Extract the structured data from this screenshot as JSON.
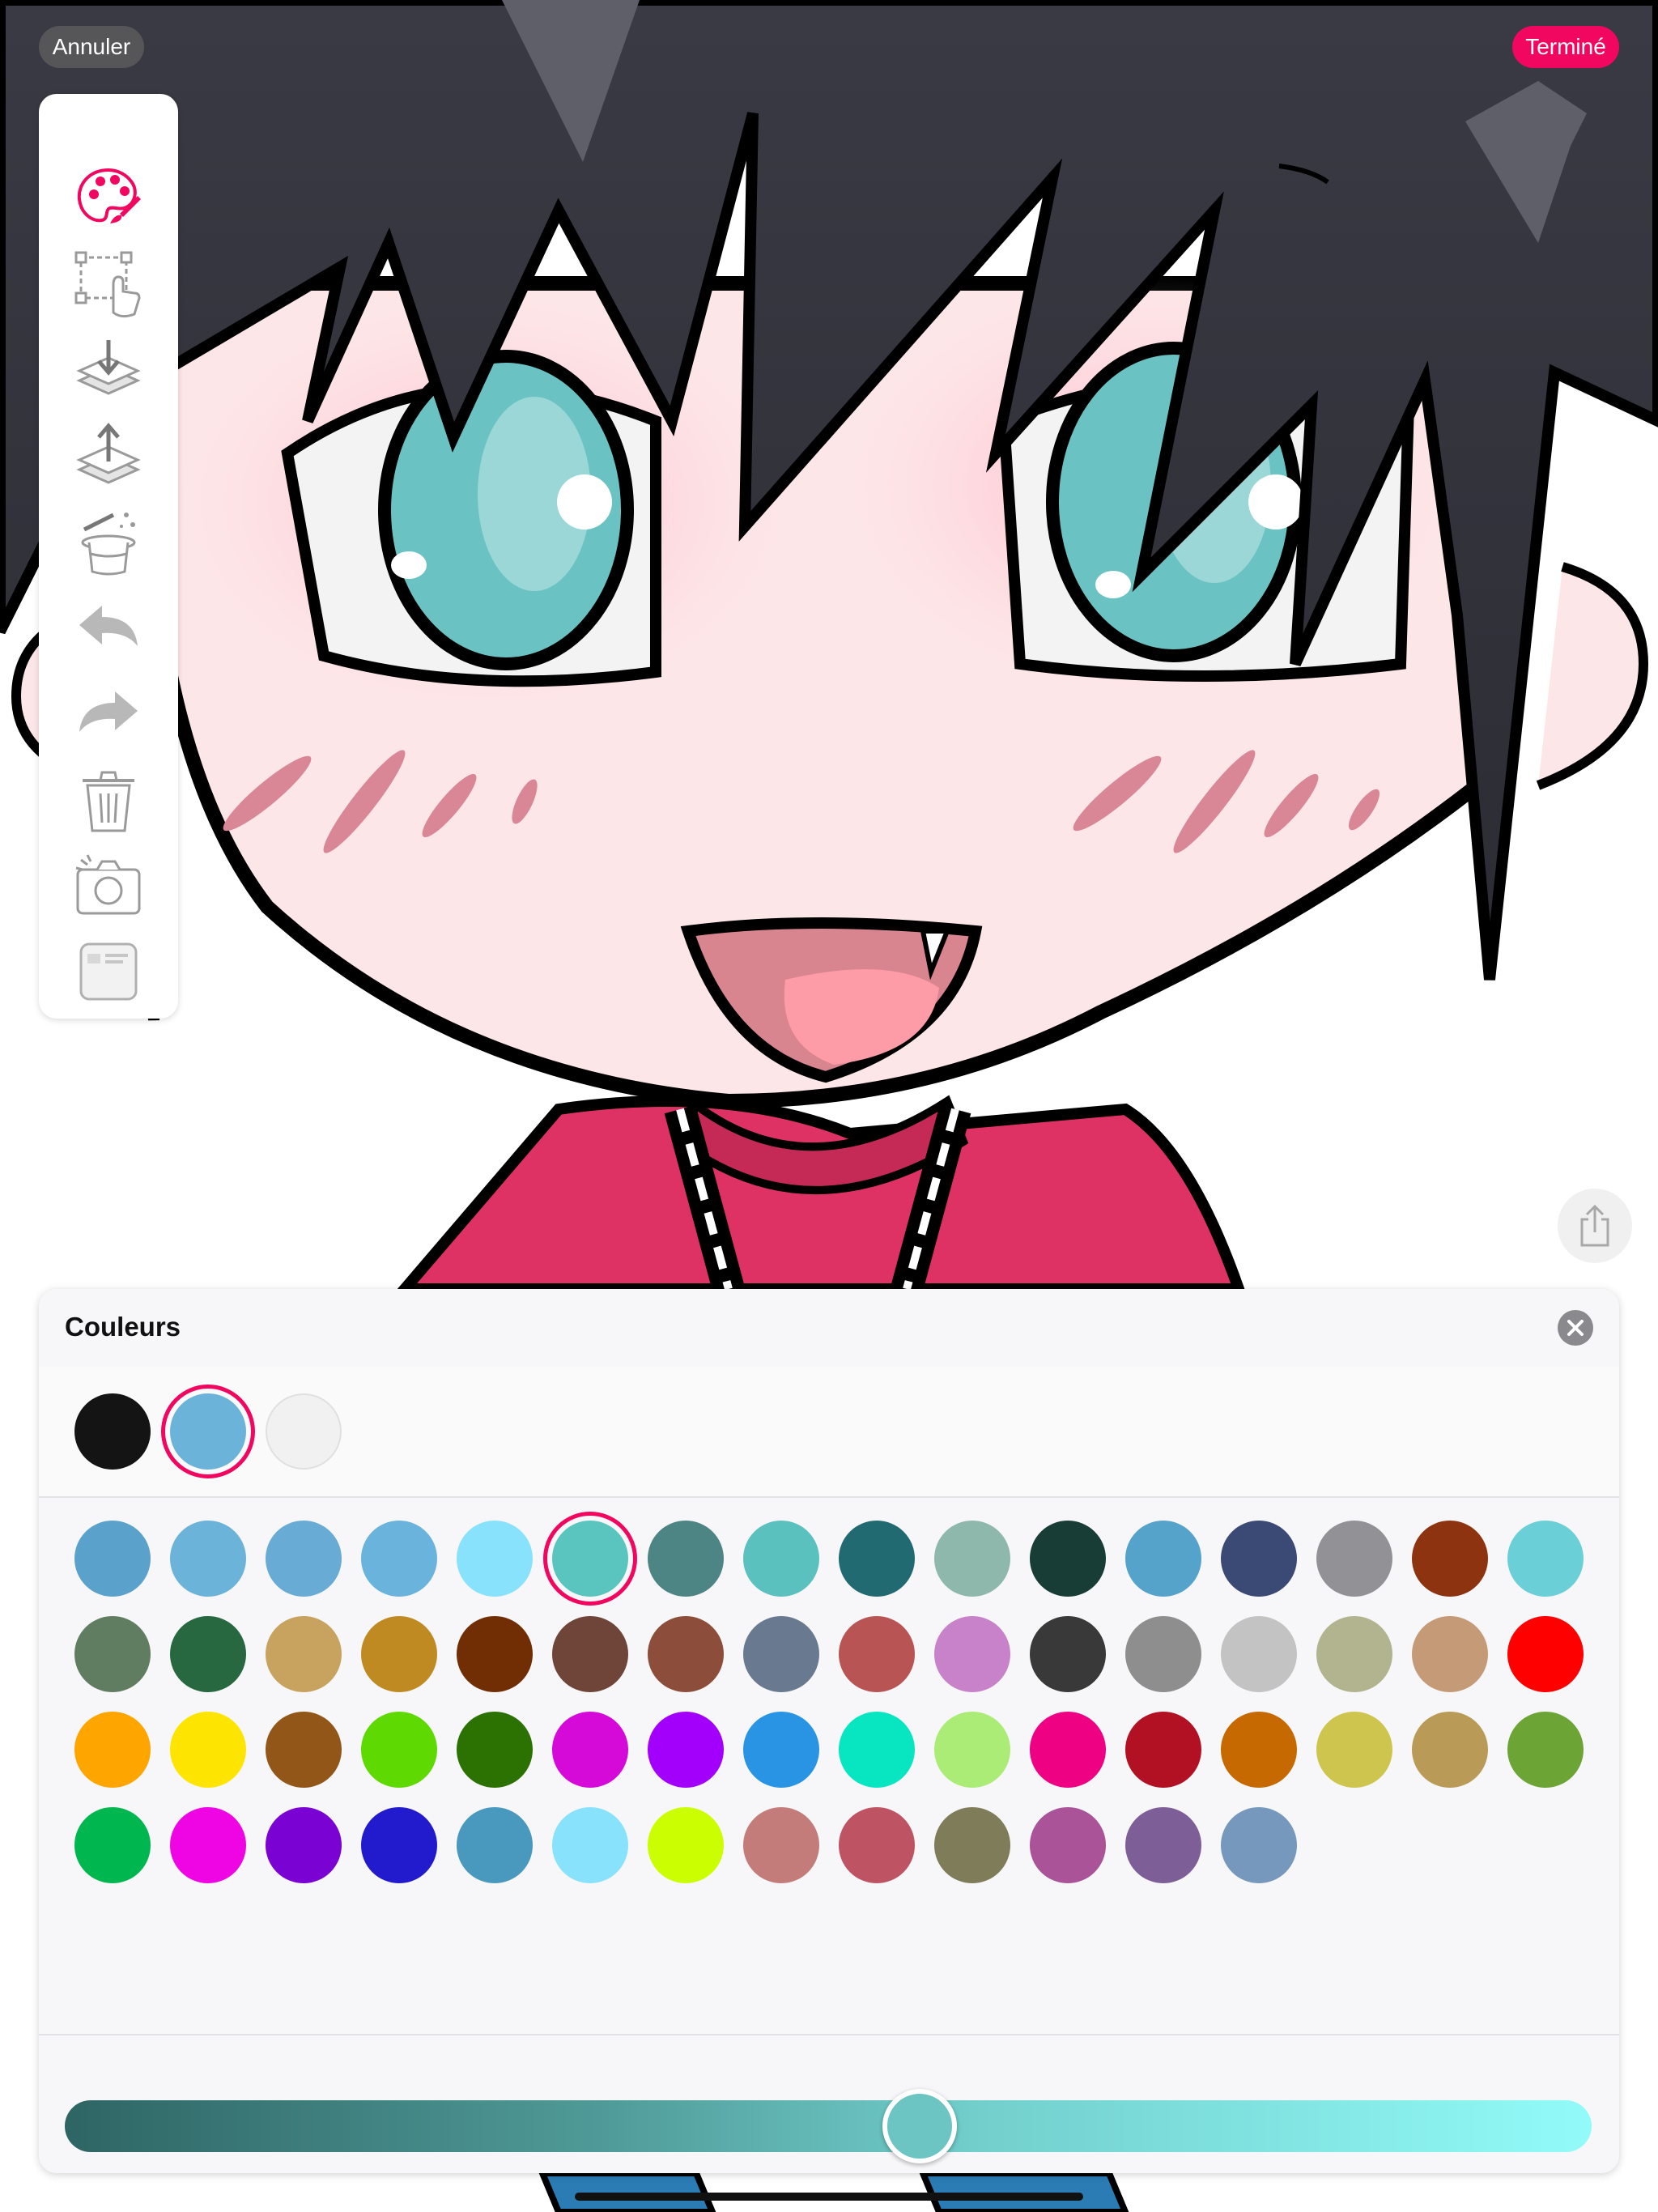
{
  "top_bar": {
    "cancel_label": "Annuler",
    "done_label": "Terminé"
  },
  "toolbar": {
    "tools": [
      "palette-icon",
      "select-transform-icon",
      "layer-down-icon",
      "layer-up-icon",
      "magic-hat-icon",
      "undo-icon",
      "redo-icon",
      "trash-icon",
      "camera-icon",
      "card-icon"
    ]
  },
  "panel": {
    "title": "Couleurs",
    "recent_colors": [
      "#141414",
      "#6cb3da",
      "#f1f1f1"
    ],
    "recent_selected_index": 1,
    "palette": [
      "#5aa2cc",
      "#6cb3da",
      "#68acd6",
      "#6ab3dc",
      "#88e2fc",
      "#5ac4bf",
      "#4c8583",
      "#5ac1bf",
      "#216a72",
      "#8db8ab",
      "#183d36",
      "#55a2cb",
      "#3b4a74",
      "#929196",
      "#8d330f",
      "#6bcfd8",
      "#617d61",
      "#276841",
      "#c7a35f",
      "#bf8a22",
      "#712e05",
      "#6f4539",
      "#8c4e3a",
      "#697990",
      "#b95455",
      "#c882c9",
      "#393939",
      "#8e8e8e",
      "#c3c3c3",
      "#b2b48f",
      "#c59a77",
      "#fe0000",
      "#fea500",
      "#fee501",
      "#925619",
      "#5fd902",
      "#2c7202",
      "#d60ad8",
      "#a200fc",
      "#2a94e4",
      "#07e6c1",
      "#aaec75",
      "#ee0183",
      "#b21123",
      "#c66900",
      "#cdc54d",
      "#b99a57",
      "#6da436",
      "#00b74f",
      "#ef05e4",
      "#7a02d2",
      "#221bcd",
      "#4999be",
      "#88e2fc",
      "#cafe01",
      "#c47c7a",
      "#be5364",
      "#7f7c59",
      "#aa5398",
      "#7d5e97",
      "#7598bc"
    ],
    "palette_selected_index": 5,
    "slider_value": 0.56
  },
  "colors": {
    "accent": "#f1075f"
  }
}
